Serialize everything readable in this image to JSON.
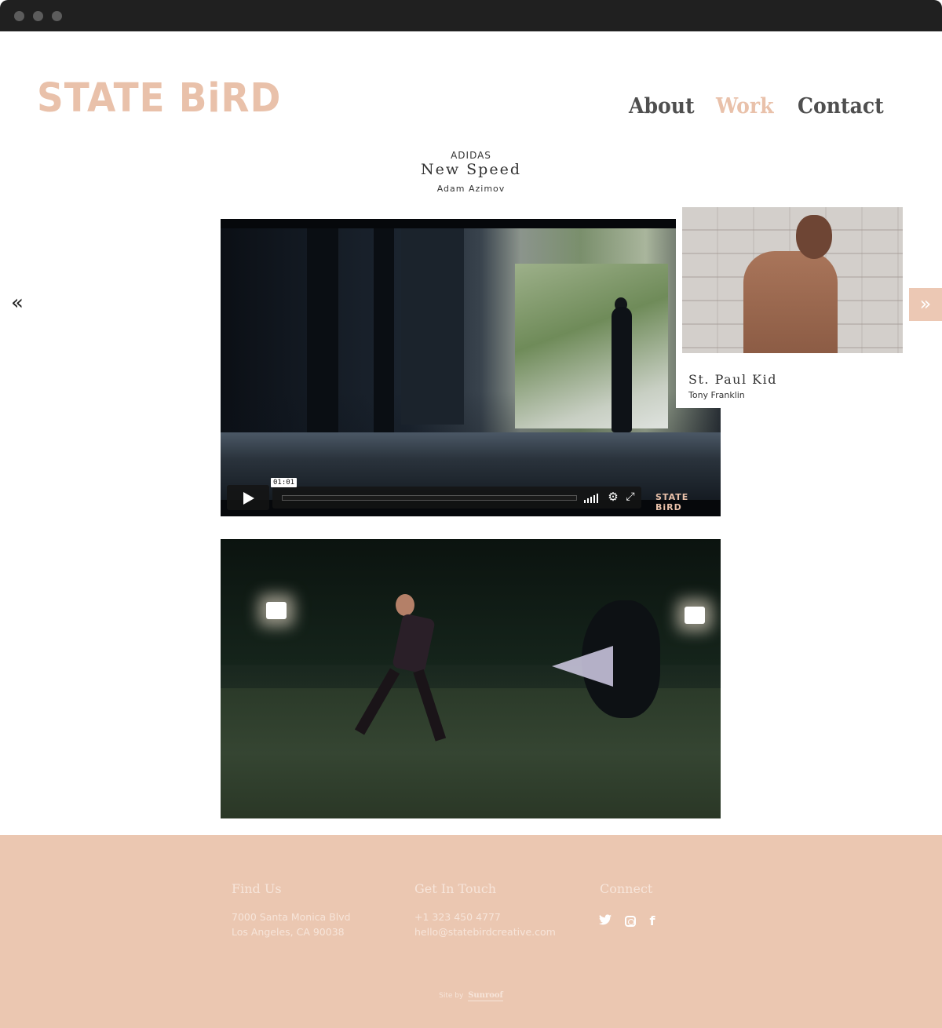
{
  "brand": {
    "logo": "STATE BiRD",
    "accent_color": "#e9c1aa"
  },
  "nav": {
    "about": "About",
    "work": "Work",
    "contact": "Contact",
    "active": "Work"
  },
  "project": {
    "client": "ADIDAS",
    "title": "New Speed",
    "director": "Adam Azimov"
  },
  "prev_arrow": "«",
  "player": {
    "timecode": "01:01",
    "watermark": "STATE BiRD",
    "gear": "⚙",
    "fullscreen": "⤢"
  },
  "next_project": {
    "title": "St. Paul Kid",
    "director": "Tony Franklin",
    "arrow": "»"
  },
  "footer": {
    "find_us": {
      "heading": "Find Us",
      "line1": "7000 Santa Monica Blvd",
      "line2": "Los Angeles, CA 90038"
    },
    "get_in_touch": {
      "heading": "Get In Touch",
      "phone": "+1 323 450 4777",
      "email": "hello@statebirdcreative.com"
    },
    "connect": {
      "heading": "Connect",
      "icons": [
        "twitter-icon",
        "instagram-icon",
        "facebook-icon"
      ],
      "twitter": "🐦",
      "facebook": "f"
    },
    "credit_prefix": "Site by",
    "credit_link": "Sunroof",
    "background_color": "#ebc7b1"
  }
}
